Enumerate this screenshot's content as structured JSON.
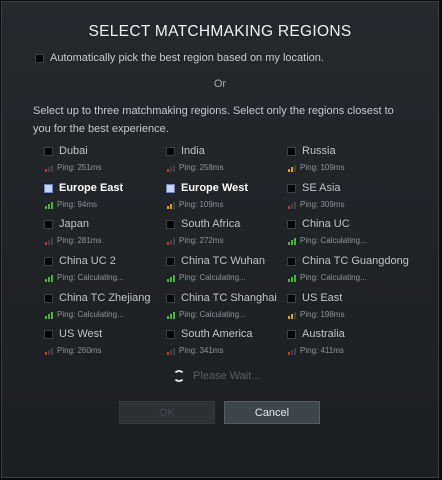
{
  "dialog": {
    "title": "SELECT MATCHMAKING REGIONS",
    "auto_pick_label": "Automatically pick the best region based on my location.",
    "or_label": "Or",
    "instructions": "Select up to three matchmaking regions. Select only the regions closest to you for the best experience.",
    "loading_text": "Please Wait...",
    "ok_label": "OK",
    "cancel_label": "Cancel"
  },
  "colors": {
    "bar_good": "#46b33a",
    "bar_fair": "#d9a21a",
    "bar_poor": "#c0392b",
    "selected_check": "#c8d2ee"
  },
  "regions": [
    {
      "name": "Dubai",
      "ping": "Ping: 251ms",
      "signal": "poor",
      "selected": false
    },
    {
      "name": "India",
      "ping": "Ping: 258ms",
      "signal": "poor",
      "selected": false
    },
    {
      "name": "Russia",
      "ping": "Ping: 109ms",
      "signal": "fair",
      "selected": false
    },
    {
      "name": "Europe East",
      "ping": "Ping: 94ms",
      "signal": "good",
      "selected": true
    },
    {
      "name": "Europe West",
      "ping": "Ping: 109ms",
      "signal": "fair",
      "selected": true
    },
    {
      "name": "SE Asia",
      "ping": "Ping: 309ms",
      "signal": "poor",
      "selected": false
    },
    {
      "name": "Japan",
      "ping": "Ping: 281ms",
      "signal": "poor",
      "selected": false
    },
    {
      "name": "South Africa",
      "ping": "Ping: 272ms",
      "signal": "poor",
      "selected": false
    },
    {
      "name": "China UC",
      "ping": "Ping: Calculating...",
      "signal": "good",
      "selected": false
    },
    {
      "name": "China UC 2",
      "ping": "Ping: Calculating...",
      "signal": "good",
      "selected": false
    },
    {
      "name": "China TC Wuhan",
      "ping": "Ping: Calculating...",
      "signal": "good",
      "selected": false
    },
    {
      "name": "China TC Guangdong",
      "ping": "Ping: Calculating...",
      "signal": "good",
      "selected": false
    },
    {
      "name": "China TC Zhejiang",
      "ping": "Ping: Calculating...",
      "signal": "good",
      "selected": false
    },
    {
      "name": "China TC Shanghai",
      "ping": "Ping: Calculating...",
      "signal": "good",
      "selected": false
    },
    {
      "name": "US East",
      "ping": "Ping: 198ms",
      "signal": "fair",
      "selected": false
    },
    {
      "name": "US West",
      "ping": "Ping: 260ms",
      "signal": "poor",
      "selected": false
    },
    {
      "name": "South America",
      "ping": "Ping: 341ms",
      "signal": "poor",
      "selected": false
    },
    {
      "name": "Australia",
      "ping": "Ping: 411ms",
      "signal": "poor",
      "selected": false
    }
  ]
}
